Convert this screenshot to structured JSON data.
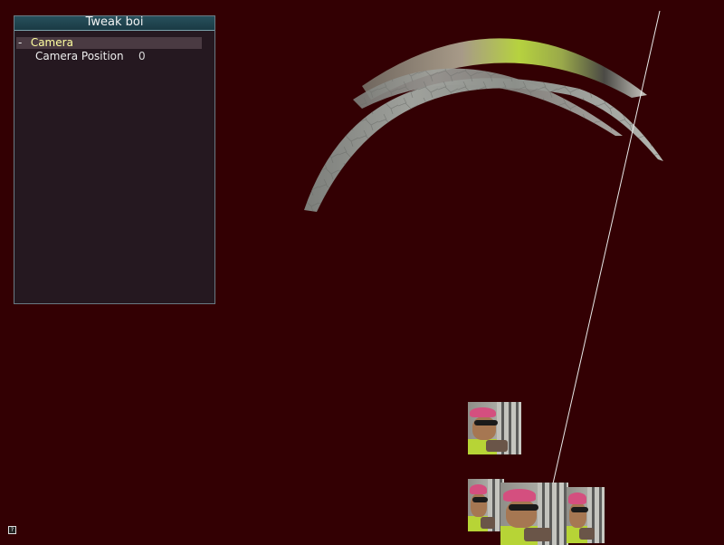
{
  "tweak_panel": {
    "title": "Tweak boi",
    "group": {
      "collapse_symbol": "-",
      "label": "Camera"
    },
    "variable": {
      "label": "Camera Position",
      "value": "0"
    }
  },
  "help_icon": {
    "glyph": "?",
    "name": "help-icon"
  },
  "colors": {
    "background": "#330003",
    "panel": "#251820",
    "title_bar": "#27505c",
    "group_label": "#ffffa0"
  }
}
